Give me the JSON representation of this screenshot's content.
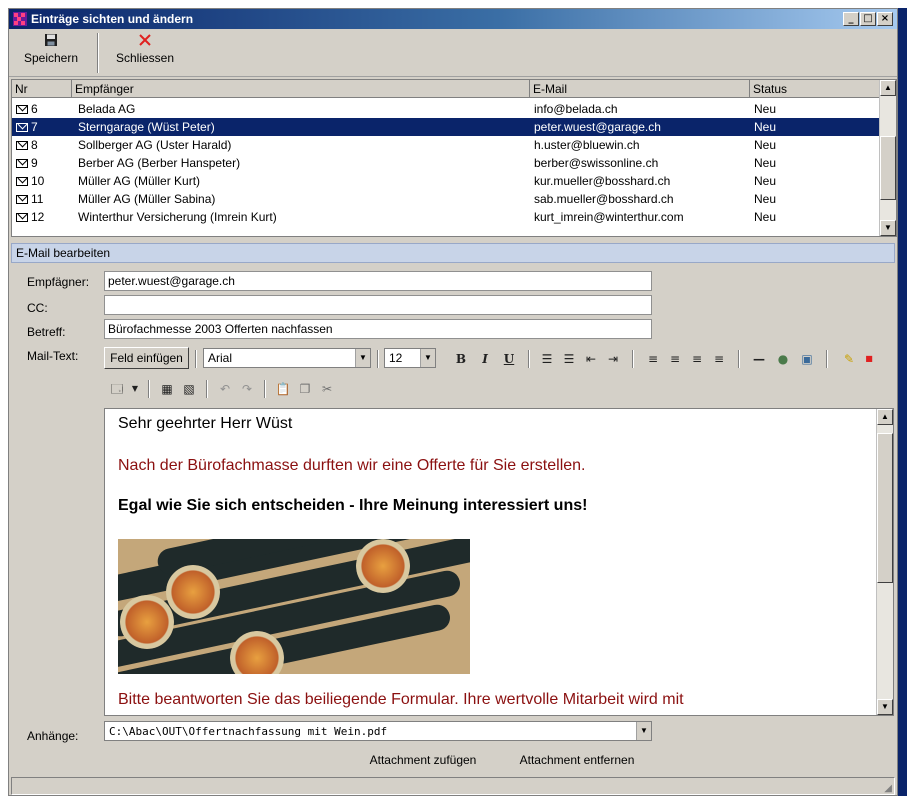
{
  "window": {
    "title": "Einträge sichten und ändern",
    "controls": [
      "_",
      "□",
      "×"
    ]
  },
  "toolbar": {
    "save_label": "Speichern",
    "close_label": "Schliessen",
    "save_icon": "floppy-disk-icon",
    "close_icon": "red-x-icon",
    "close_icon_color": "#e02020"
  },
  "list": {
    "columns": [
      "Nr",
      "Empfänger",
      "E-Mail",
      "Status"
    ],
    "rows": [
      {
        "nr": "6",
        "recipient": "Belada AG",
        "email": "info@belada.ch",
        "status": "Neu"
      },
      {
        "nr": "7",
        "recipient": "Sterngarage  (Wüst Peter)",
        "email": "peter.wuest@garage.ch",
        "status": "Neu"
      },
      {
        "nr": "8",
        "recipient": "Sollberger AG  (Uster Harald)",
        "email": "h.uster@bluewin.ch",
        "status": "Neu"
      },
      {
        "nr": "9",
        "recipient": "Berber AG  (Berber Hanspeter)",
        "email": "berber@swissonline.ch",
        "status": "Neu"
      },
      {
        "nr": "10",
        "recipient": "Müller AG  (Müller Kurt)",
        "email": "kur.mueller@bosshard.ch",
        "status": "Neu"
      },
      {
        "nr": "11",
        "recipient": "Müller AG  (Müller Sabina)",
        "email": "sab.mueller@bosshard.ch",
        "status": "Neu"
      },
      {
        "nr": "12",
        "recipient": "Winterthur Versicherung  (Imrein Kurt)",
        "email": "kurt_imrein@winterthur.com",
        "status": "Neu"
      }
    ],
    "selected_index": 1
  },
  "editor_section": {
    "header": "E-Mail bearbeiten",
    "recipient_label": "Empfägner:",
    "recipient_value": "peter.wuest@garage.ch",
    "cc_label": "CC:",
    "cc_value": "",
    "subject_label": "Betreff:",
    "subject_value": "Bürofachmesse 2003 Offerten nachfassen",
    "mailtext_label": "Mail-Text:",
    "insert_field_label": "Feld einfügen",
    "font_value": "Arial",
    "size_value": "12"
  },
  "message": {
    "line1": "Sehr geehrter Herr Wüst",
    "line2": "Nach der Bürofachmasse durften wir eine Offerte für Sie erstellen.",
    "line3": "Egal wie Sie sich entscheiden - Ihre Meinung interessiert uns!",
    "line4": "Bitte beantworten Sie das beiliegende Formular. Ihre wertvolle Mitarbeit wird mit",
    "line2_color": "#8b1010",
    "line4_color": "#8b1010"
  },
  "attachments": {
    "label": "Anhänge:",
    "value": "C:\\Abac\\OUT\\Offertnachfassung mit Wein.pdf",
    "add_label": "Attachment zufügen",
    "remove_label": "Attachment entfernen"
  },
  "colors": {
    "selection": "#0a246a",
    "section_header": "#c8d4e8"
  }
}
